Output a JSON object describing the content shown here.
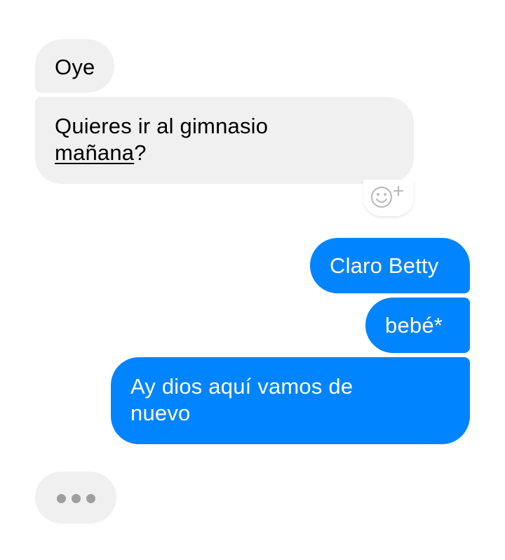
{
  "conversation": {
    "messages": [
      {
        "direction": "incoming",
        "text": "Oye"
      },
      {
        "direction": "incoming",
        "lines": [
          "Quieres ir al gimnasio",
          "mañana",
          "?"
        ]
      },
      {
        "direction": "outgoing",
        "text": "Claro Betty"
      },
      {
        "direction": "outgoing",
        "text": "bebé*"
      },
      {
        "direction": "outgoing",
        "lines": [
          "Ay dios aquí vamos de",
          "nuevo"
        ]
      }
    ],
    "reaction_button": {
      "icon": "smiley-plus-icon",
      "symbol": "+"
    },
    "typing_indicator": {
      "icon": "typing-dots-icon"
    }
  },
  "colors": {
    "incoming_bubble": "#f0f0f0",
    "outgoing_bubble": "#0084ff",
    "typing_dots": "#9e9e9e"
  }
}
